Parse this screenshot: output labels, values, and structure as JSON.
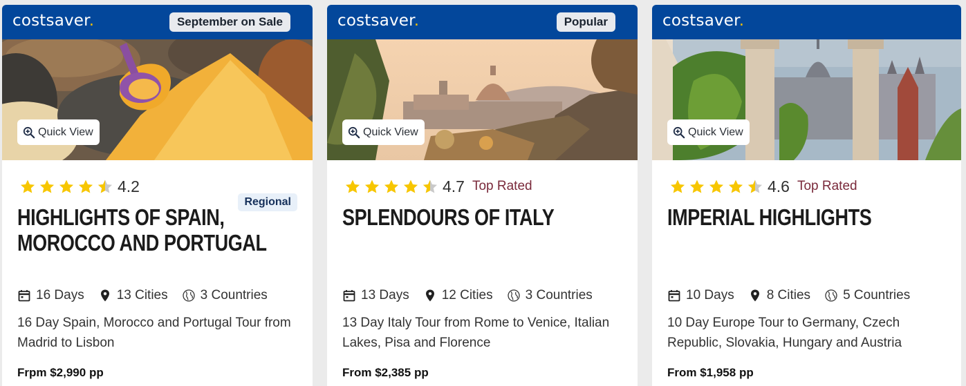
{
  "cards": [
    {
      "brand": "costsaver",
      "brand_dot": ".",
      "badge": "September on Sale",
      "quick_view": "Quick View",
      "rating": "4.2",
      "tag": "Regional",
      "title_line1": "HIGHLIGHTS OF SPAIN,",
      "title_line2": "MOROCCO AND PORTUGAL",
      "days": "16 Days",
      "cities": "13 Cities",
      "countries": "3 Countries",
      "desc": "16 Day Spain, Morocco and Portugal Tour from Madrid to Lisbon",
      "price": "Frpm $2,990 pp",
      "stars": 4.5
    },
    {
      "brand": "costsaver",
      "brand_dot": ".",
      "badge": "Popular",
      "quick_view": "Quick View",
      "rating": "4.7",
      "top_rated": "Top Rated",
      "title_line1": "SPLENDOURS OF ITALY",
      "title_line2": "",
      "days": "13 Days",
      "cities": "12 Cities",
      "countries": "3 Countries",
      "desc": "13 Day Italy Tour from Rome to Venice, Italian Lakes, Pisa and Florence",
      "price": "From $2,385 pp",
      "stars": 4.5
    },
    {
      "brand": "costsaver",
      "brand_dot": ".",
      "quick_view": "Quick View",
      "rating": "4.6",
      "top_rated": "Top Rated",
      "title_line1": "IMPERIAL HIGHLIGHTS",
      "title_line2": "",
      "days": "10 Days",
      "cities": "8 Cities",
      "countries": "5 Countries",
      "desc": "10 Day Europe Tour to Germany, Czech Republic, Slovakia, Hungary and Austria",
      "price": "From $1,958 pp",
      "stars": 4.5
    }
  ],
  "colors": {
    "header": "#03479b",
    "brand_dot": "#f6c100",
    "star": "#f7c600",
    "top_rated": "#7a2a3b"
  },
  "icons": [
    "search-plus-icon",
    "star-icon",
    "calendar-icon",
    "map-pin-icon",
    "globe-icon"
  ]
}
